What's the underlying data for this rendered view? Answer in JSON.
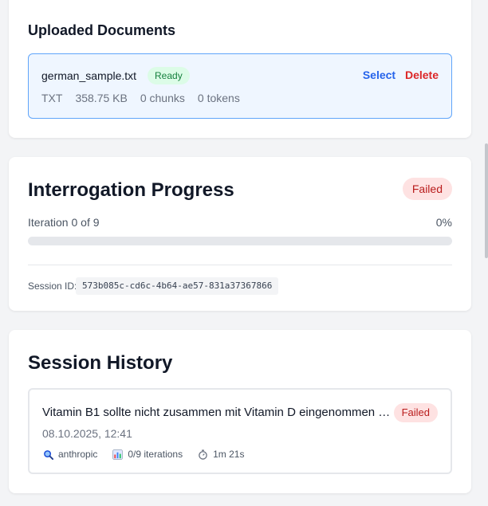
{
  "uploaded_documents": {
    "title": "Uploaded Documents",
    "documents": [
      {
        "name": "german_sample.txt",
        "status": "Ready",
        "type": "TXT",
        "size": "358.75 KB",
        "chunks": "0 chunks",
        "tokens": "0 tokens",
        "select_label": "Select",
        "delete_label": "Delete"
      }
    ]
  },
  "progress": {
    "title": "Interrogation Progress",
    "status": "Failed",
    "iteration_text": "Iteration 0 of 9",
    "percent_text": "0%",
    "percent_value": 0,
    "session_label": "Session ID:",
    "session_id": "573b085c-cd6c-4b64-ae57-831a37367866"
  },
  "history": {
    "title": "Session History",
    "sessions": [
      {
        "query": "Vitamin B1 sollte nicht zusammen mit Vitamin D eingenommen werden",
        "status": "Failed",
        "date": "08.10.2025, 12:41",
        "provider": "anthropic",
        "provider_icon": "magnifier-icon",
        "iterations": "0/9 iterations",
        "iterations_icon": "bar-chart-icon",
        "duration": "1m 21s",
        "duration_icon": "stopwatch-icon"
      }
    ]
  },
  "colors": {
    "accent": "#2563eb",
    "danger": "#dc2626",
    "success_bg": "#dcfce7",
    "success_text": "#15803d",
    "failed_bg": "#fee2e2",
    "failed_text": "#b91c1c",
    "selected_border": "#60a5fa",
    "selected_bg": "#eff6ff"
  }
}
